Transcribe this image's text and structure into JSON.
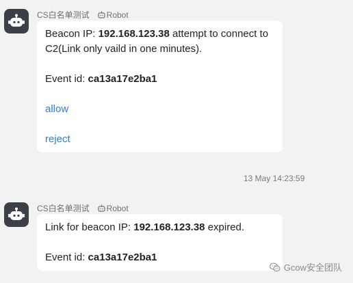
{
  "messages": [
    {
      "sender_name": "CS白名单测试",
      "robot_label": "Robot",
      "line1_prefix": "Beacon IP: ",
      "ip": "192.168.123.38",
      "line1_suffix": " attempt to connect to C2(Link only vaild in one minutes).",
      "event_label": "Event id: ",
      "event_id": "ca13a17e2ba1",
      "allow_label": "allow",
      "reject_label": "reject"
    },
    {
      "sender_name": "CS白名单测试",
      "robot_label": "Robot",
      "line1_prefix": "Link for beacon IP: ",
      "ip": "192.168.123.38",
      "line1_suffix": " expired.",
      "event_label": "Event id: ",
      "event_id": "ca13a17e2ba1"
    }
  ],
  "timestamp": "13 May 14:23:59",
  "watermark": "Gcow安全团队",
  "icons": {
    "avatar": "robot-avatar-icon",
    "robot_badge": "robot-badge-icon",
    "watermark": "wechat-icon"
  },
  "colors": {
    "link": "#2f7fd8",
    "avatar_bg": "#3b4048",
    "page_bg": "#f2f2f2"
  }
}
